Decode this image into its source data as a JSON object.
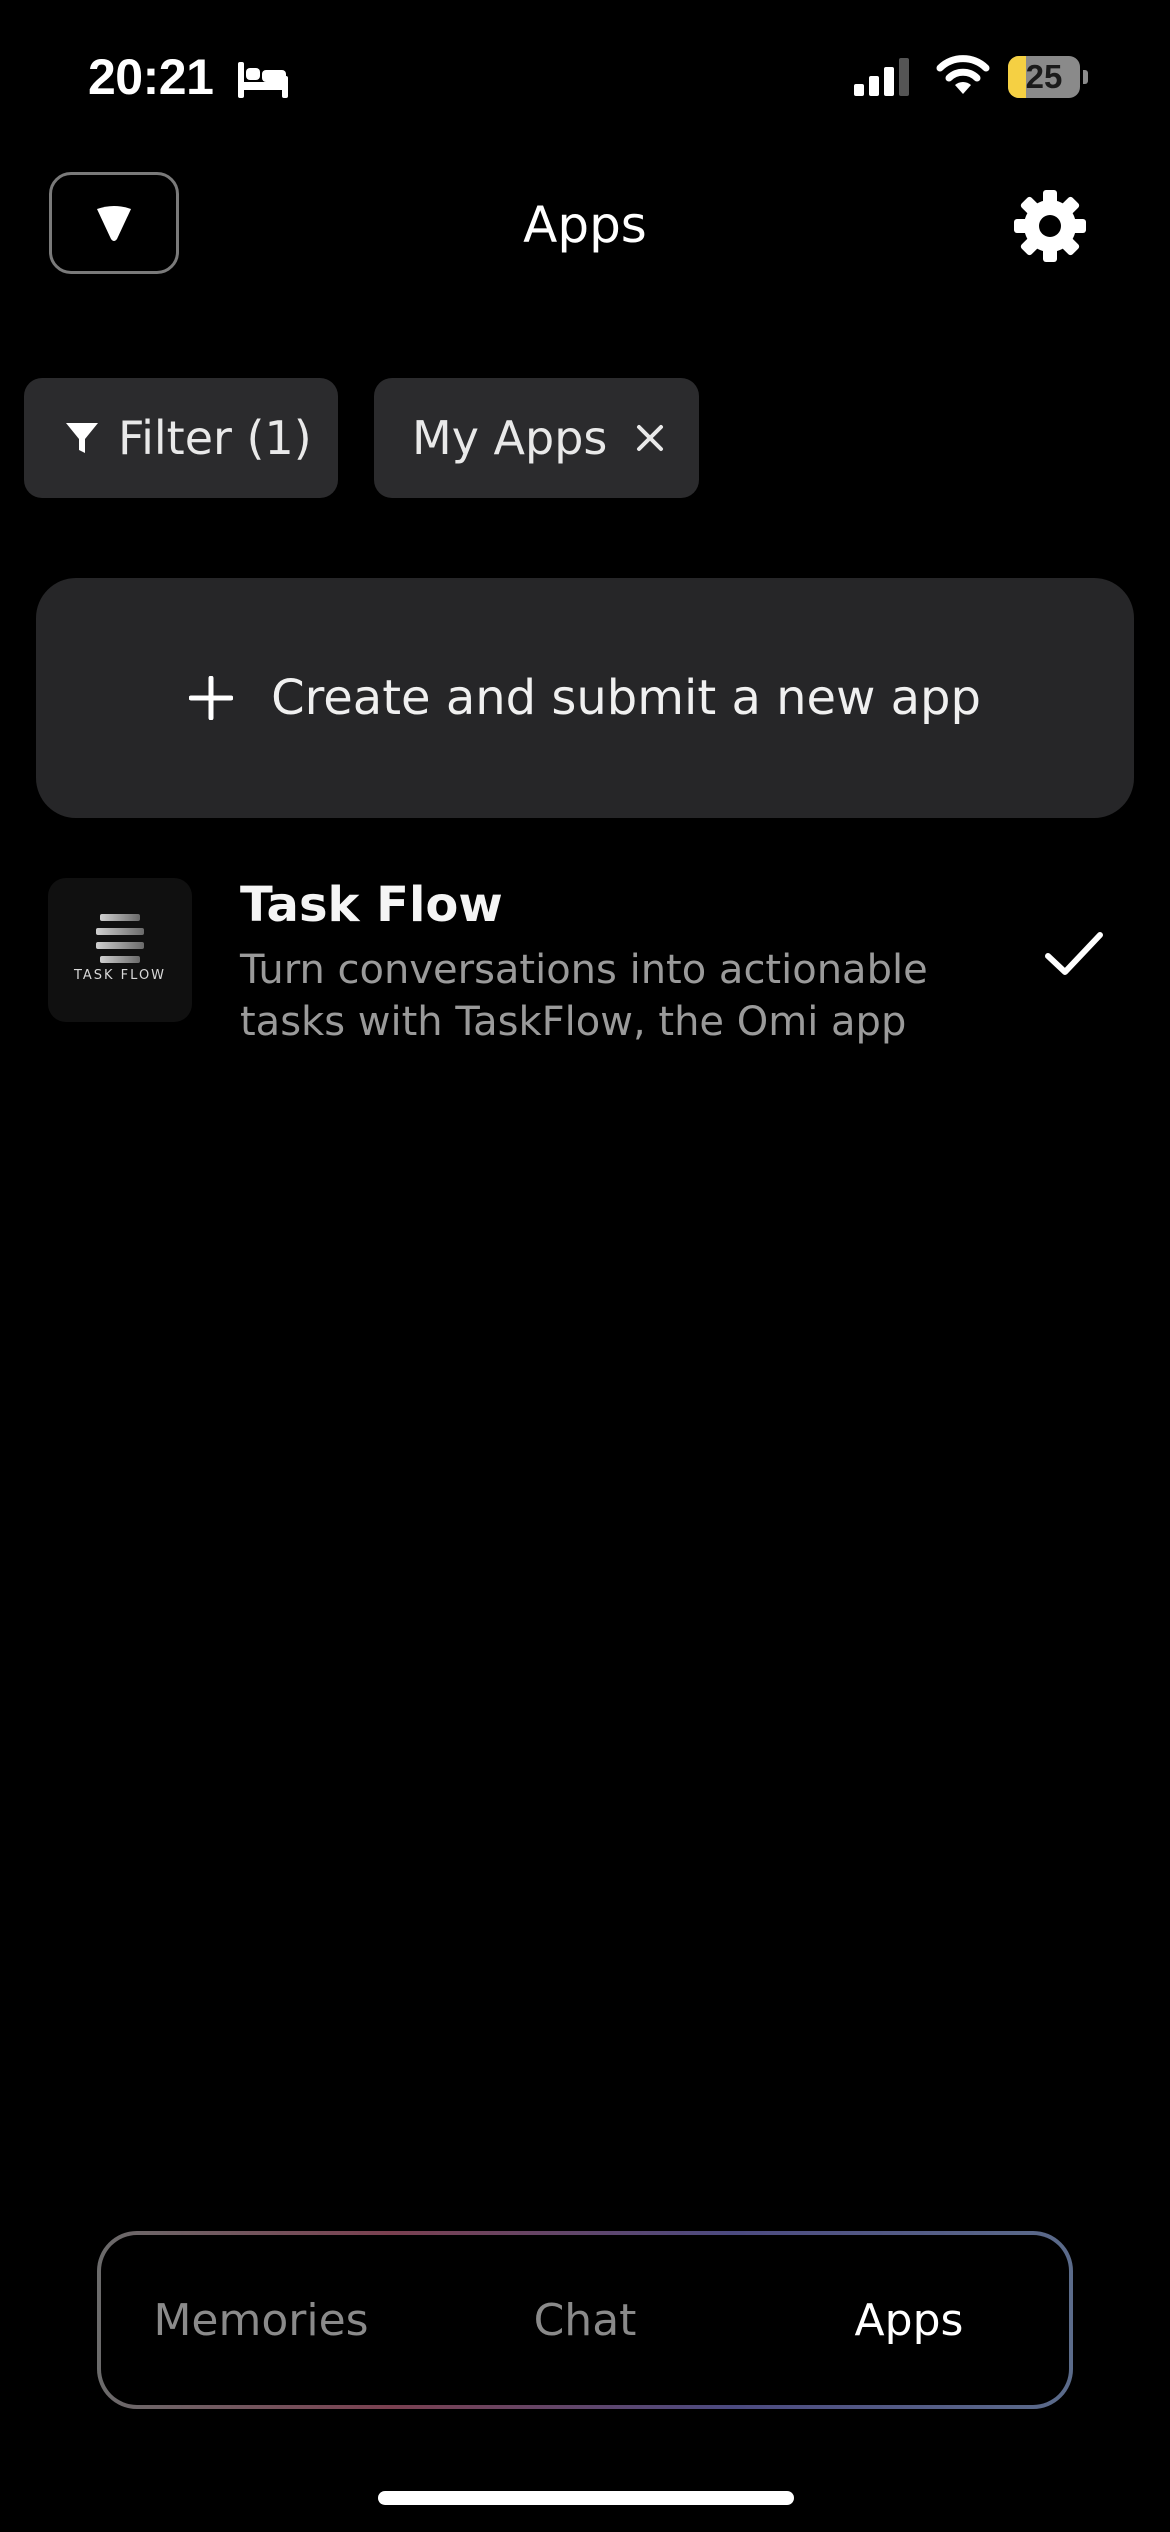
{
  "status_bar": {
    "time": "20:21",
    "battery_level": "25",
    "battery_fraction": 0.25,
    "battery_fill_color": "#f5d043",
    "icons": [
      "bed-icon",
      "signal-icon",
      "wifi-icon",
      "battery-icon"
    ]
  },
  "header": {
    "title": "Apps",
    "left_button_icon": "omi-device-icon",
    "right_button_icon": "gear-icon"
  },
  "filters": {
    "filter_label": "Filter (1)",
    "active_chips": [
      {
        "label": "My Apps",
        "icon": "close-icon"
      }
    ]
  },
  "create_card": {
    "label": "Create and submit a new app",
    "icon": "plus-icon"
  },
  "apps": [
    {
      "name": "Task Flow",
      "icon_text": "TASK FLOW",
      "description": "Turn conversations into actionable tasks with TaskFlow, the Omi app",
      "enabled": true
    }
  ],
  "bottom_nav": {
    "tabs": [
      {
        "label": "Memories",
        "active": false
      },
      {
        "label": "Chat",
        "active": false
      },
      {
        "label": "Apps",
        "active": true
      }
    ]
  },
  "colors": {
    "background": "#000000",
    "chip_background": "#2b2b2d",
    "card_background": "#262628",
    "secondary_text": "#9a9a9a"
  }
}
